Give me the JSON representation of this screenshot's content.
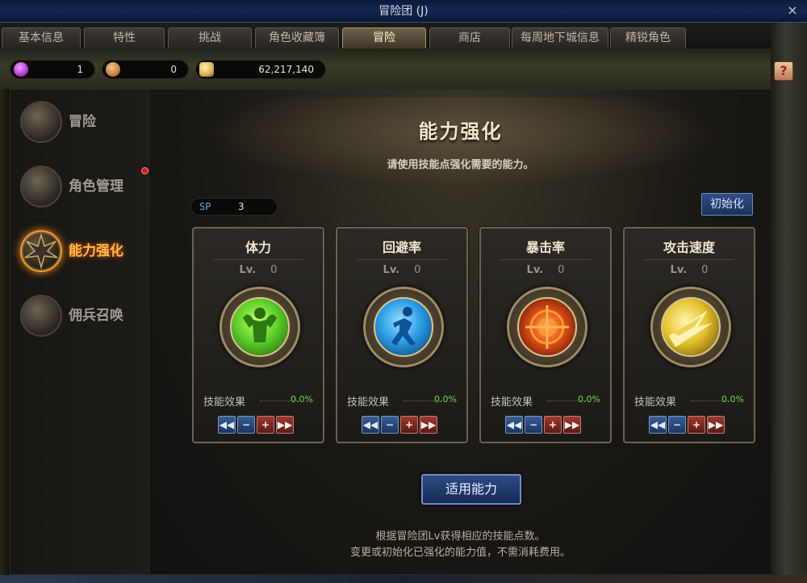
{
  "window": {
    "title": "冒险团 (J)",
    "close_glyph": "×"
  },
  "tabs": [
    {
      "label": "基本信息"
    },
    {
      "label": "特性"
    },
    {
      "label": "挑战"
    },
    {
      "label": "角色收藏簿"
    },
    {
      "label": "冒险"
    },
    {
      "label": "商店"
    },
    {
      "label": "每周地下城信息"
    },
    {
      "label": "精锐角色"
    }
  ],
  "active_tab": "冒险",
  "currency": [
    {
      "icon": "purple-gem-icon",
      "value": "1",
      "color": "#b23ad6"
    },
    {
      "icon": "bronze-coin-icon",
      "value": "0",
      "color": "#c8843e"
    },
    {
      "icon": "gold-pile-icon",
      "value": "62,217,140",
      "color": "#e0b85a"
    }
  ],
  "help_glyph": "?",
  "sidebar": {
    "items": [
      {
        "label": "冒险",
        "icon": "flag-banner-icon",
        "active": false,
        "badge": false
      },
      {
        "label": "角色管理",
        "icon": "character-icon",
        "active": false,
        "badge": true
      },
      {
        "label": "能力强化",
        "icon": "spiked-star-icon",
        "active": true,
        "badge": false
      },
      {
        "label": "佣兵召唤",
        "icon": "chest-icon",
        "active": false,
        "badge": false
      }
    ]
  },
  "panel": {
    "title": "能力强化",
    "subtitle": "请使用技能点强化需要的能力。",
    "sp_label": "SP",
    "sp_value": "3",
    "reset_label": "初始化",
    "apply_label": "适用能力",
    "note_line1": "根据冒险团Lv获得相应的技能点数。",
    "note_line2": "变更或初始化已强化的能力值，不需消耗费用。"
  },
  "stats": [
    {
      "name": "体力",
      "lv_label": "Lv.",
      "lv": "0",
      "effect_label": "技能效果",
      "effect": "0.0%",
      "icon": "muscle-figure-icon",
      "color": "#5ecf2a"
    },
    {
      "name": "回避率",
      "lv_label": "Lv.",
      "lv": "0",
      "effect_label": "技能效果",
      "effect": "0.0%",
      "icon": "running-figure-icon",
      "color": "#2a9ee6"
    },
    {
      "name": "暴击率",
      "lv_label": "Lv.",
      "lv": "0",
      "effect_label": "技能效果",
      "effect": "0.0%",
      "icon": "crosshair-icon",
      "color": "#e6521a"
    },
    {
      "name": "攻击速度",
      "lv_label": "Lv.",
      "lv": "0",
      "effect_label": "技能效果",
      "effect": "0.0%",
      "icon": "slash-blade-icon",
      "color": "#e6c22a"
    }
  ],
  "stepper": {
    "min": "◀◀",
    "minus": "−",
    "plus": "+",
    "max": "▶▶"
  }
}
